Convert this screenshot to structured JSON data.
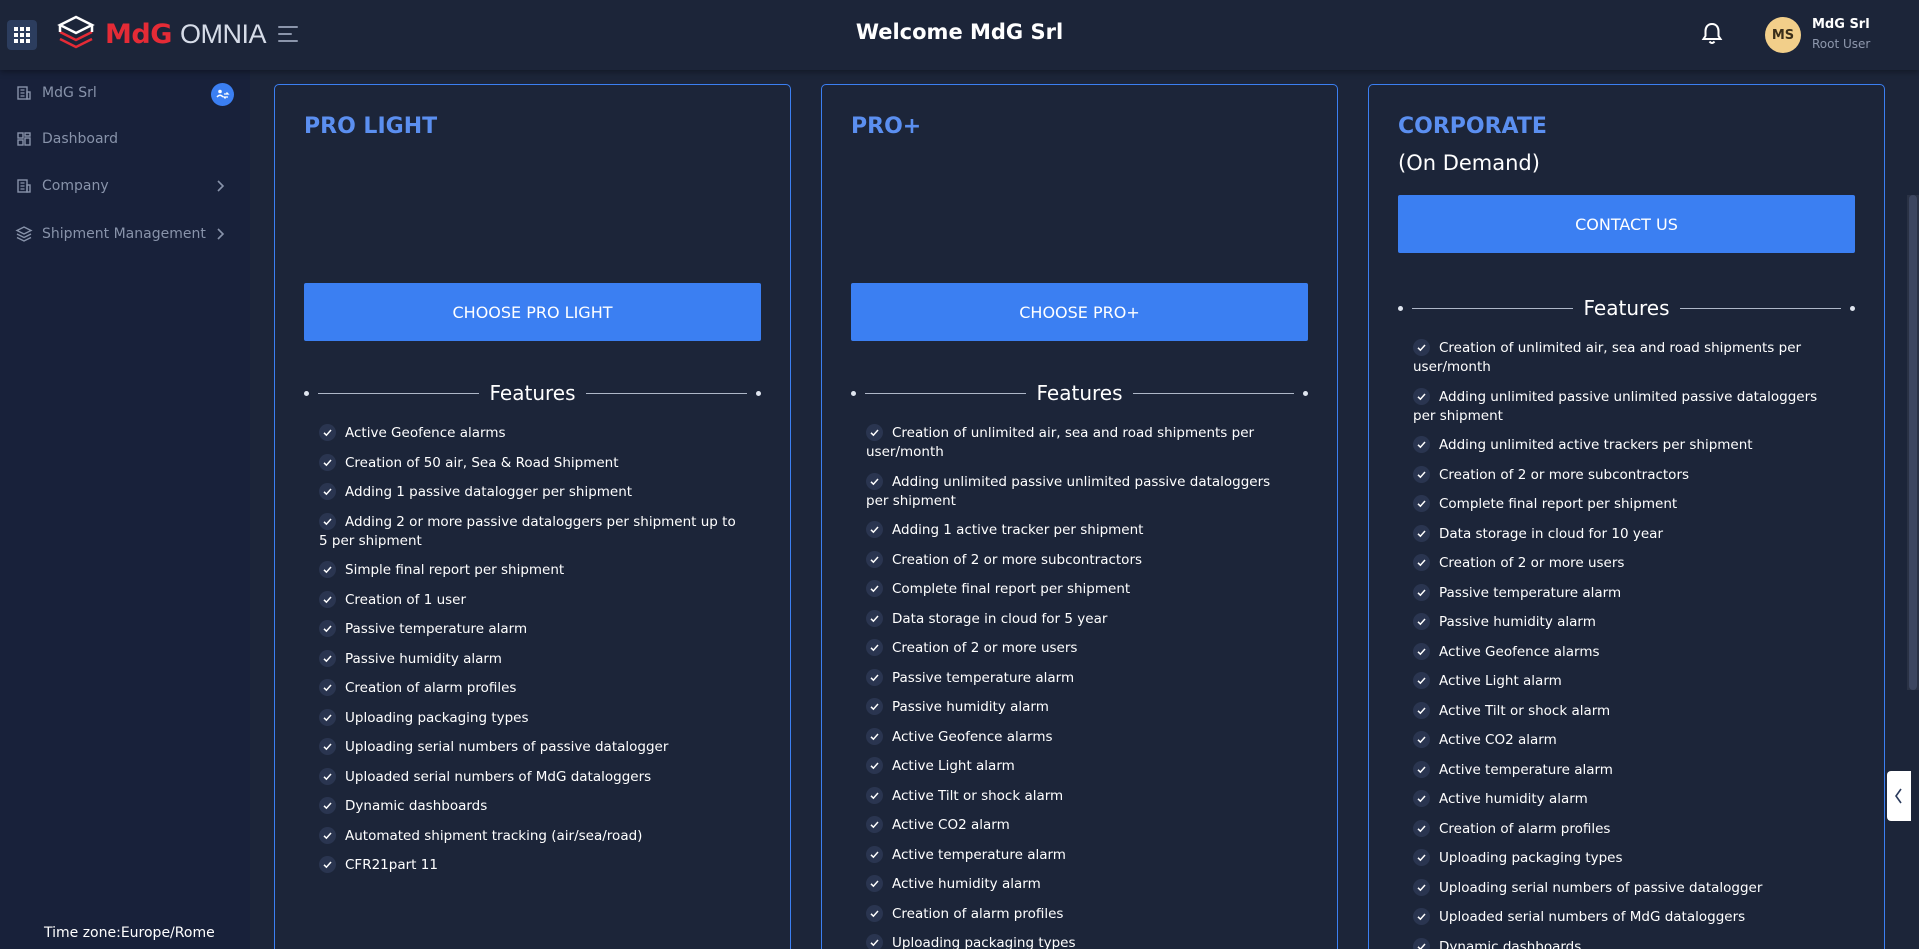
{
  "header": {
    "logo_brand": "MdG",
    "logo_product": "OMNIA",
    "welcome": "Welcome MdG Srl",
    "user": {
      "initials": "MS",
      "name": "MdG Srl",
      "role": "Root User"
    }
  },
  "sidebar": {
    "items": [
      {
        "label": "MdG Srl"
      },
      {
        "label": "Dashboard"
      },
      {
        "label": "Company"
      },
      {
        "label": "Shipment Management"
      }
    ],
    "timezone": "Time zone:Europe/Rome"
  },
  "colors": {
    "background": "#1c2539",
    "sidebar": "#18213a",
    "accent": "#3b7ff2",
    "title": "#5b8ff0",
    "logo_red": "#e52b36"
  },
  "plans": [
    {
      "title": "PRO LIGHT",
      "subtitle": "",
      "button": "CHOOSE PRO LIGHT",
      "features_heading": "Features",
      "features": [
        "Active Geofence alarms",
        "Creation of 50 air, Sea & Road Shipment",
        "Adding 1 passive datalogger per shipment",
        "Adding 2 or more passive dataloggers per shipment up to 5 per shipment",
        "Simple final report per shipment",
        "Creation of 1 user",
        "Passive temperature alarm",
        "Passive humidity alarm",
        "Creation of alarm profiles",
        "Uploading packaging types",
        "Uploading serial numbers of passive datalogger",
        "Uploaded serial numbers of MdG dataloggers",
        "Dynamic dashboards",
        "Automated shipment tracking (air/sea/road)",
        "CFR21part 11"
      ]
    },
    {
      "title": "PRO+",
      "subtitle": "",
      "button": "CHOOSE PRO+",
      "features_heading": "Features",
      "features": [
        "Creation of unlimited air, sea and road shipments per user/month",
        "Adding unlimited passive unlimited passive dataloggers per shipment",
        "Adding 1 active tracker per shipment",
        "Creation of 2 or more subcontractors",
        "Complete final report per shipment",
        "Data storage in cloud for 5 year",
        "Creation of 2 or more users",
        "Passive temperature alarm",
        "Passive humidity alarm",
        "Active Geofence alarms",
        "Active Light alarm",
        "Active Tilt or shock alarm",
        "Active CO2 alarm",
        "Active temperature alarm",
        "Active humidity alarm",
        "Creation of alarm profiles",
        "Uploading packaging types"
      ]
    },
    {
      "title": "CORPORATE",
      "subtitle": "(On Demand)",
      "button": "CONTACT US",
      "features_heading": "Features",
      "features": [
        "Creation of unlimited air, sea and road shipments per user/month",
        "Adding unlimited passive unlimited passive dataloggers per shipment",
        "Adding unlimited active trackers per shipment",
        "Creation of 2 or more subcontractors",
        "Complete final report per shipment",
        "Data storage in cloud for 10 year",
        "Creation of 2 or more users",
        "Passive temperature alarm",
        "Passive humidity alarm",
        "Active Geofence alarms",
        "Active Light alarm",
        "Active Tilt or shock alarm",
        "Active CO2 alarm",
        "Active temperature alarm",
        "Active humidity alarm",
        "Creation of alarm profiles",
        "Uploading packaging types",
        "Uploading serial numbers of passive datalogger",
        "Uploaded serial numbers of MdG dataloggers",
        "Dynamic dashboards"
      ]
    }
  ]
}
